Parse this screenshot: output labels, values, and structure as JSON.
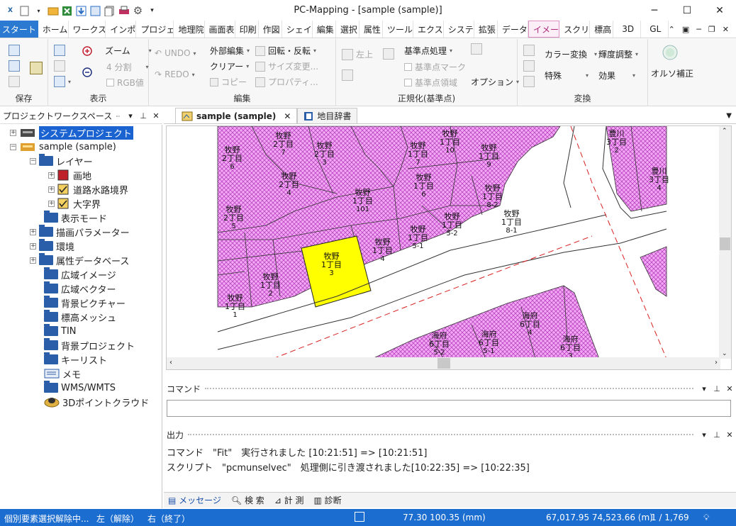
{
  "window": {
    "title": "PC-Mapping - [sample (sample)]",
    "minimize": "─",
    "maximize": "☐",
    "close": "✕"
  },
  "ribbon_tabs": [
    "スタート",
    "ホーム",
    "ワークス",
    "インポ",
    "プロジェ",
    "地理院",
    "画面表",
    "印刷",
    "作図",
    "シェイ",
    "編集",
    "選択",
    "属性",
    "ツール",
    "エクス",
    "システ",
    "拡張",
    "データ",
    "イメー",
    "スクリ",
    "標高",
    "3D",
    "GL"
  ],
  "ribbon_active_tab": "イメー",
  "ribbon": {
    "save": {
      "label": "保存"
    },
    "view": {
      "label": "表示",
      "zoom": "ズーム",
      "split4": "4 分割",
      "rgb": "RGB値"
    },
    "edit": {
      "label": "編集",
      "undo": "UNDO",
      "redo": "REDO",
      "external_edit": "外部編集",
      "clear": "クリアー",
      "copy": "コピー",
      "rotate_flip": "回転・反転",
      "resize": "サイズ変更...",
      "property": "プロパティ..."
    },
    "normalize": {
      "label": "正規化(基準点)",
      "top_left": "左上",
      "ref_process": "基準点処理",
      "ref_mark": "基準点マーク",
      "ref_area": "基準点領域",
      "option": "オプション"
    },
    "convert": {
      "label": "変換",
      "color_convert": "カラー変換",
      "special": "特殊",
      "gradation": "輝度調整",
      "effect": "効果",
      "ortho": "オルソ補正"
    }
  },
  "workspace": {
    "title": "プロジェクトワークスペース",
    "tree": [
      {
        "label": "システムプロジェクト",
        "level": 0,
        "selected": true
      },
      {
        "label": "sample (sample)",
        "level": 0
      },
      {
        "label": "レイヤー",
        "level": 1
      },
      {
        "label": "画地",
        "level": 2
      },
      {
        "label": "道路水路境界",
        "level": 2
      },
      {
        "label": "大字界",
        "level": 2
      },
      {
        "label": "表示モード",
        "level": 1
      },
      {
        "label": "描画パラメーター",
        "level": 1
      },
      {
        "label": "環境",
        "level": 1
      },
      {
        "label": "属性データベース",
        "level": 1
      },
      {
        "label": "広域イメージ",
        "level": 1
      },
      {
        "label": "広域ベクター",
        "level": 1
      },
      {
        "label": "背景ピクチャー",
        "level": 1
      },
      {
        "label": "標高メッシュ",
        "level": 1
      },
      {
        "label": "TIN",
        "level": 1
      },
      {
        "label": "背景プロジェクト",
        "level": 1
      },
      {
        "label": "キーリスト",
        "level": 1
      },
      {
        "label": "メモ",
        "level": 1
      },
      {
        "label": "WMS/WMTS",
        "level": 1
      },
      {
        "label": "3Dポイントクラウド",
        "level": 1
      }
    ]
  },
  "doc_tabs": [
    {
      "label": "sample (sample)",
      "active": true
    },
    {
      "label": "地目辞書",
      "active": false
    }
  ],
  "map": {
    "parcel_fill": "#ee8cf0",
    "selected_fill": "#ffff00",
    "labels": [
      {
        "town": "牧野",
        "chome": "2丁目",
        "no": "6"
      },
      {
        "town": "牧野",
        "chome": "2丁目",
        "no": "7"
      },
      {
        "town": "牧野",
        "chome": "2丁目",
        "no": "3"
      },
      {
        "town": "牧野",
        "chome": "1丁目",
        "no": "7"
      },
      {
        "town": "牧野",
        "chome": "1丁目",
        "no": "10"
      },
      {
        "town": "牧野",
        "chome": "1丁目",
        "no": "9"
      },
      {
        "town": "牧野",
        "chome": "2丁目",
        "no": "4"
      },
      {
        "town": "牧野",
        "chome": "1丁目",
        "no": "6"
      },
      {
        "town": "牧野",
        "chome": "1丁目",
        "no": "8-2"
      },
      {
        "town": "牧野",
        "chome": "1丁目",
        "no": "101"
      },
      {
        "town": "牧野",
        "chome": "2丁目",
        "no": "5"
      },
      {
        "town": "牧野",
        "chome": "1丁目",
        "no": "5-2"
      },
      {
        "town": "牧野",
        "chome": "1丁目",
        "no": "8-1"
      },
      {
        "town": "牧野",
        "chome": "1丁目",
        "no": "4"
      },
      {
        "town": "牧野",
        "chome": "1丁目",
        "no": "5-1"
      },
      {
        "town": "牧野",
        "chome": "1丁目",
        "no": "3"
      },
      {
        "town": "牧野",
        "chome": "1丁目",
        "no": "2"
      },
      {
        "town": "牧野",
        "chome": "1丁目",
        "no": "1"
      },
      {
        "town": "豊川",
        "chome": "3丁目",
        "no": "4"
      },
      {
        "town": "豊川",
        "chome": "3丁目",
        "no": "2"
      },
      {
        "town": "海府",
        "chome": "6丁目",
        "no": "4"
      },
      {
        "town": "海府",
        "chome": "6丁目",
        "no": "5-1"
      },
      {
        "town": "海府",
        "chome": "6丁目",
        "no": "5-2"
      },
      {
        "town": "海府",
        "chome": "6丁目",
        "no": "3"
      }
    ]
  },
  "command_panel": {
    "title": "コマンド",
    "value": ""
  },
  "output_panel": {
    "title": "出力",
    "lines": [
      "コマンド　\"Fit\"　実行されました [10:21:51] => [10:21:51]",
      "スクリプト　\"pcmunselvec\"　処理側に引き渡されました[10:22:35] => [10:22:35]"
    ],
    "tabs": [
      "メッセージ",
      "検 索",
      "計 測",
      "診断"
    ]
  },
  "statusbar": {
    "mode": "個別要素選択解除中...",
    "left_btn": "左（解除）",
    "right_btn": "右（終了）",
    "mm_coord": "77.30 100.35 (mm)",
    "map_coord": "67,017.95 74,523.66 (m)",
    "scale": "1 / 1,769"
  }
}
